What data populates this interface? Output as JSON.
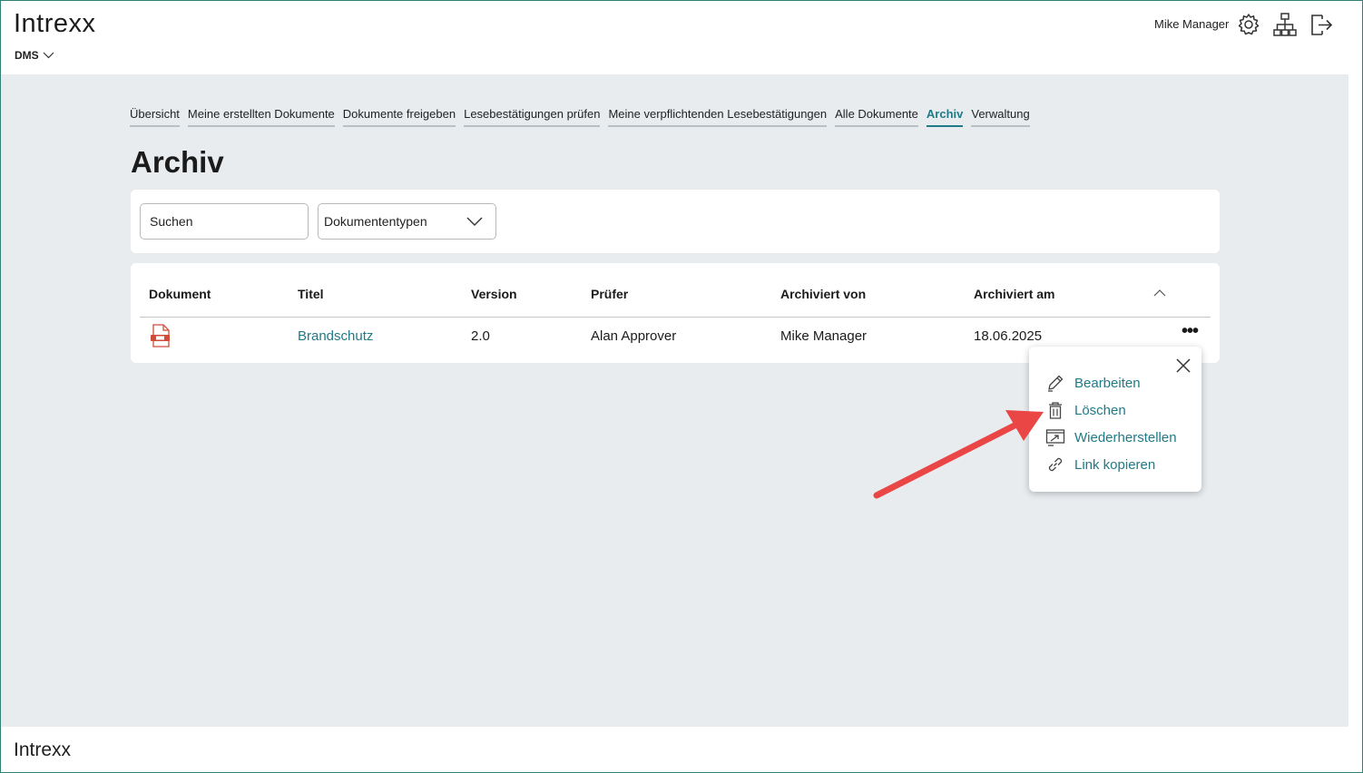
{
  "header": {
    "logo": "Intrexx",
    "app_switch": "DMS",
    "user": "Mike Manager"
  },
  "tabs": [
    {
      "label": "Übersicht",
      "active": false
    },
    {
      "label": "Meine erstellten Dokumente",
      "active": false
    },
    {
      "label": "Dokumente freigeben",
      "active": false
    },
    {
      "label": "Lesebestätigungen prüfen",
      "active": false
    },
    {
      "label": "Meine verpflichtenden Lesebestätigungen",
      "active": false
    },
    {
      "label": "Alle Dokumente",
      "active": false
    },
    {
      "label": "Archiv",
      "active": true
    },
    {
      "label": "Verwaltung",
      "active": false
    }
  ],
  "page_title": "Archiv",
  "filters": {
    "search_placeholder": "Suchen",
    "doctype_label": "Dokumententypen"
  },
  "table": {
    "columns": [
      "Dokument",
      "Titel",
      "Version",
      "Prüfer",
      "Archiviert von",
      "Archiviert am"
    ],
    "rows": [
      {
        "title": "Brandschutz",
        "version": "2.0",
        "reviewer": "Alan Approver",
        "archived_by": "Mike Manager",
        "archived_on": "18.06.2025"
      }
    ],
    "more_label": "•••"
  },
  "context_menu": {
    "items": [
      {
        "label": "Bearbeiten",
        "icon": "pencil-icon"
      },
      {
        "label": "Löschen",
        "icon": "trash-icon"
      },
      {
        "label": "Wiederherstellen",
        "icon": "restore-icon"
      },
      {
        "label": "Link kopieren",
        "icon": "link-icon"
      }
    ]
  },
  "footer": {
    "logo": "Intrexx"
  },
  "colors": {
    "accent": "#217a86",
    "background": "#e8ecef",
    "annotation_arrow": "#ea4646"
  }
}
